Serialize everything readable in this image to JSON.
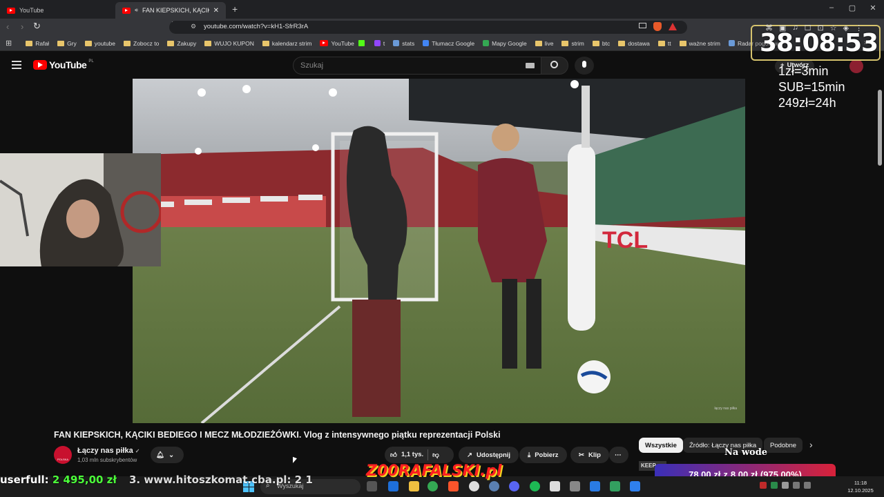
{
  "browser": {
    "tabs": [
      {
        "title": "YouTube",
        "active": false
      },
      {
        "title": "FAN KIEPSKICH, KĄCIKI BEDIE",
        "active": true
      }
    ],
    "new_tab": "+",
    "url": "youtube.com/watch?v=kH1-SfrR3rA",
    "window_controls": {
      "minimize": "–",
      "maximize": "▢",
      "close": "✕"
    },
    "bookmarks": [
      "Rafał",
      "Gry",
      "youtube",
      "Zobocz to",
      "Zakupy",
      "WUJO KUPON",
      "kalendarz strim",
      "YouTube",
      "t",
      "stats",
      "Tłumacz Google",
      "Mapy Google",
      "live",
      "strim",
      "btc",
      "dostawa",
      "tt",
      "ważne strim",
      "Radar pogodowy"
    ],
    "bookmarks_more": "»"
  },
  "youtube": {
    "logo": "YouTube",
    "region": "PL",
    "search_placeholder": "Szukaj",
    "create_label": "Utwórz",
    "video_title": "FAN KIEPSKICH, KĄCIKI BEDIEGO I MECZ MŁODZIEŻÓWKI. Vlog z intensywnego piątku reprezentacji Polski",
    "channel_name": "Łączy nas piłka",
    "channel_verified": "✓",
    "subscribers": "1,03 mln subskrybentów",
    "channel_avatar_label": "POLSKA",
    "likes": "1,1 tys.",
    "share": "Udostępnij",
    "download": "Pobierz",
    "clip": "Klip",
    "more": "⋯",
    "chips": [
      "Wszystkie",
      "Źródło: Łączy nas piłka",
      "Podobne"
    ],
    "chips_next": "›",
    "video_watermark": "łączy nas piłka"
  },
  "overlay": {
    "timer": "38:08:53",
    "prices": [
      "1zł=3min",
      "SUB=15min",
      "249zł=24h"
    ],
    "ticker_left": "userfull: 2 495,00 zł",
    "ticker_mid": "3. www.hitoszkomat.cba.pl: 2 1",
    "logo_text": "Z00RAFALSKI.pl",
    "na_wode": "Na wode",
    "keep": "KEEP",
    "goal_amount": "78,00 zł",
    "goal_sep": "z",
    "goal_target": "8,00 zł",
    "goal_pct": "(975.00%)"
  },
  "taskbar": {
    "search_placeholder": "Wyszukaj",
    "time": "11:18",
    "date": "12.10.2025"
  },
  "colors": {
    "accent_red": "#ff0000",
    "timer_border": "#d6c36e",
    "ticker_green": "#4cff3a",
    "goal_grad_start": "#3a2fb8",
    "goal_grad_end": "#d8223a"
  }
}
